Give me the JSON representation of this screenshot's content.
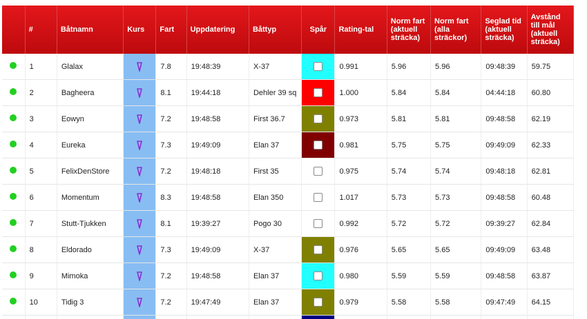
{
  "headers": {
    "status": "",
    "num": "#",
    "name": "Båtnamn",
    "kurs": "Kurs",
    "fart": "Fart",
    "uppdatering": "Uppdatering",
    "battyp": "Båttyp",
    "spar": "Spår",
    "rating": "Rating-tal",
    "norm_aktuell": "Norm fart (aktuell sträcka)",
    "norm_alla": "Norm fart (alla sträckor)",
    "seglad": "Seglad tid (aktuell sträcka)",
    "avstand": "Avstånd till mål (aktuell sträcka)"
  },
  "colors": {
    "status_dot": "#22d022",
    "kurs_cell": "#88bdf3",
    "arrow": "#8a2fd0"
  },
  "rows": [
    {
      "num": "1",
      "name": "Glalax",
      "fart": "7.8",
      "uppdatering": "19:48:39",
      "battyp": "X-37",
      "spar_color": "#22ffff",
      "rating": "0.991",
      "norm_aktuell": "5.96",
      "norm_alla": "5.96",
      "seglad": "09:48:39",
      "avstand": "59.75"
    },
    {
      "num": "2",
      "name": "Bagheera",
      "fart": "8.1",
      "uppdatering": "19:44:18",
      "battyp": "Dehler 39 sq",
      "spar_color": "#ff0000",
      "rating": "1.000",
      "norm_aktuell": "5.84",
      "norm_alla": "5.84",
      "seglad": "04:44:18",
      "avstand": "60.80"
    },
    {
      "num": "3",
      "name": "Eowyn",
      "fart": "7.2",
      "uppdatering": "19:48:58",
      "battyp": "First 36.7",
      "spar_color": "#808000",
      "rating": "0.973",
      "norm_aktuell": "5.81",
      "norm_alla": "5.81",
      "seglad": "09:48:58",
      "avstand": "62.19"
    },
    {
      "num": "4",
      "name": "Eureka",
      "fart": "7.3",
      "uppdatering": "19:49:09",
      "battyp": "Elan 37",
      "spar_color": "#800000",
      "rating": "0.981",
      "norm_aktuell": "5.75",
      "norm_alla": "5.75",
      "seglad": "09:49:09",
      "avstand": "62.33"
    },
    {
      "num": "5",
      "name": "FelixDenStore",
      "fart": "7.2",
      "uppdatering": "19:48:18",
      "battyp": "First 35",
      "spar_color": "",
      "rating": "0.975",
      "norm_aktuell": "5.74",
      "norm_alla": "5.74",
      "seglad": "09:48:18",
      "avstand": "62.81"
    },
    {
      "num": "6",
      "name": "Momentum",
      "fart": "8.3",
      "uppdatering": "19:48:58",
      "battyp": "Elan 350",
      "spar_color": "",
      "rating": "1.017",
      "norm_aktuell": "5.73",
      "norm_alla": "5.73",
      "seglad": "09:48:58",
      "avstand": "60.48"
    },
    {
      "num": "7",
      "name": "Stutt-Tjukken",
      "fart": "8.1",
      "uppdatering": "19:39:27",
      "battyp": "Pogo 30",
      "spar_color": "",
      "rating": "0.992",
      "norm_aktuell": "5.72",
      "norm_alla": "5.72",
      "seglad": "09:39:27",
      "avstand": "62.84"
    },
    {
      "num": "8",
      "name": "Eldorado",
      "fart": "7.3",
      "uppdatering": "19:49:09",
      "battyp": "X-37",
      "spar_color": "#808000",
      "rating": "0.976",
      "norm_aktuell": "5.65",
      "norm_alla": "5.65",
      "seglad": "09:49:09",
      "avstand": "63.48"
    },
    {
      "num": "9",
      "name": "Mimoka",
      "fart": "7.2",
      "uppdatering": "19:48:58",
      "battyp": "Elan 37",
      "spar_color": "#22ffff",
      "rating": "0.980",
      "norm_aktuell": "5.59",
      "norm_alla": "5.59",
      "seglad": "09:48:58",
      "avstand": "63.87"
    },
    {
      "num": "10",
      "name": "Tidig 3",
      "fart": "7.2",
      "uppdatering": "19:47:49",
      "battyp": "Elan 37",
      "spar_color": "#808000",
      "rating": "0.979",
      "norm_aktuell": "5.58",
      "norm_alla": "5.58",
      "seglad": "09:47:49",
      "avstand": "64.15"
    }
  ],
  "partial_row": {
    "spar_color": "#000080"
  }
}
